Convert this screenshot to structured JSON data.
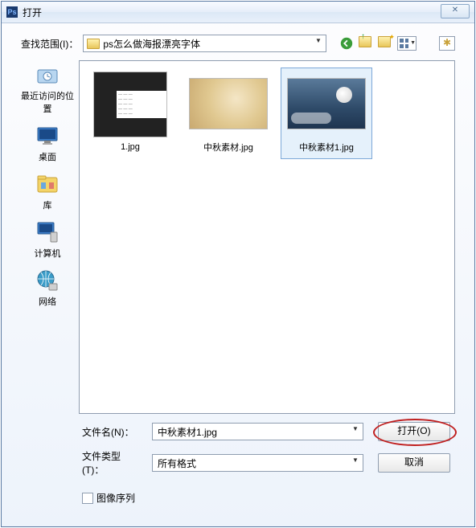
{
  "title": "打开",
  "look_in": {
    "label": "查找范围(I)：",
    "value": "ps怎么做海报漂亮字体"
  },
  "places": [
    {
      "id": "recent",
      "label": "最近访问的位置"
    },
    {
      "id": "desktop",
      "label": "桌面"
    },
    {
      "id": "libraries",
      "label": "库"
    },
    {
      "id": "computer",
      "label": "计算机"
    },
    {
      "id": "network",
      "label": "网络"
    }
  ],
  "files": [
    {
      "name": "1.jpg",
      "selected": false,
      "kind": "screenshot"
    },
    {
      "name": "中秋素材.jpg",
      "selected": false,
      "kind": "warm"
    },
    {
      "name": "中秋素材1.jpg",
      "selected": true,
      "kind": "moon"
    }
  ],
  "file_name": {
    "label": "文件名(N)：",
    "value": "中秋素材1.jpg"
  },
  "file_type": {
    "label": "文件类型(T)：",
    "value": "所有格式"
  },
  "buttons": {
    "open": "打开(O)",
    "cancel": "取消"
  },
  "checkbox": {
    "label": "图像序列",
    "checked": false
  },
  "icons": {
    "back": "back-icon",
    "up": "up-folder-icon",
    "new": "new-folder-icon",
    "view": "view-menu-icon",
    "fav": "favorites-icon"
  }
}
